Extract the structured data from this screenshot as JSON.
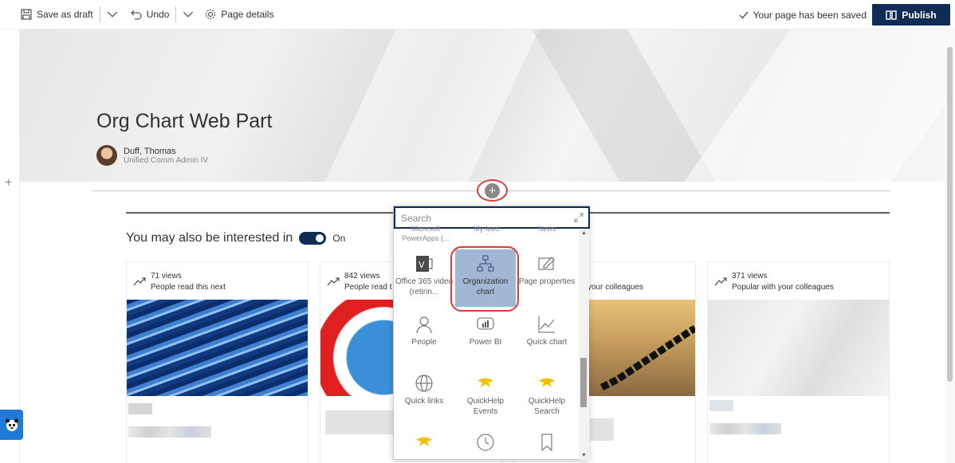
{
  "command_bar": {
    "save_draft": "Save as draft",
    "undo": "Undo",
    "page_details": "Page details",
    "saved_status": "Your page has been saved",
    "publish": "Publish"
  },
  "hero": {
    "title": "Org Chart Web Part",
    "author_name": "Duff, Thomas",
    "author_role": "Unified Comm Admin IV"
  },
  "section": {
    "heading": "You may also be interested in",
    "toggle_label": "On"
  },
  "cards": [
    {
      "views": "71 views",
      "reason": "People read this next"
    },
    {
      "views": "842 views",
      "reason": "People read t"
    },
    {
      "views": "",
      "reason": "your colleagues"
    },
    {
      "views": "371 views",
      "reason": "Popular with your colleagues"
    }
  ],
  "toolbox": {
    "search_placeholder": "Search",
    "top_partial": [
      "Microsoft PowerApps (...",
      "My feed",
      "News"
    ],
    "tiles": [
      {
        "label": "Office 365 video (retirin...",
        "icon": "office-video-icon"
      },
      {
        "label": "Organization chart",
        "icon": "org-chart-icon",
        "selected": true
      },
      {
        "label": "Page properties",
        "icon": "page-properties-icon"
      },
      {
        "label": "People",
        "icon": "person-icon"
      },
      {
        "label": "Power BI",
        "icon": "power-bi-icon"
      },
      {
        "label": "Quick chart",
        "icon": "quick-chart-icon"
      },
      {
        "label": "Quick links",
        "icon": "globe-icon"
      },
      {
        "label": "QuickHelp Events",
        "icon": "quickhelp-icon"
      },
      {
        "label": "QuickHelp Search",
        "icon": "quickhelp-icon"
      },
      {
        "label": "",
        "icon": "quickhelp-icon"
      },
      {
        "label": "",
        "icon": "clock-icon"
      },
      {
        "label": "",
        "icon": "bookmark-icon"
      }
    ]
  },
  "colors": {
    "accent": "#0f2c54",
    "selection": "#a2b7d4",
    "highlight_ring": "#e03a3a",
    "quickhelp_yellow": "#f2c200"
  }
}
